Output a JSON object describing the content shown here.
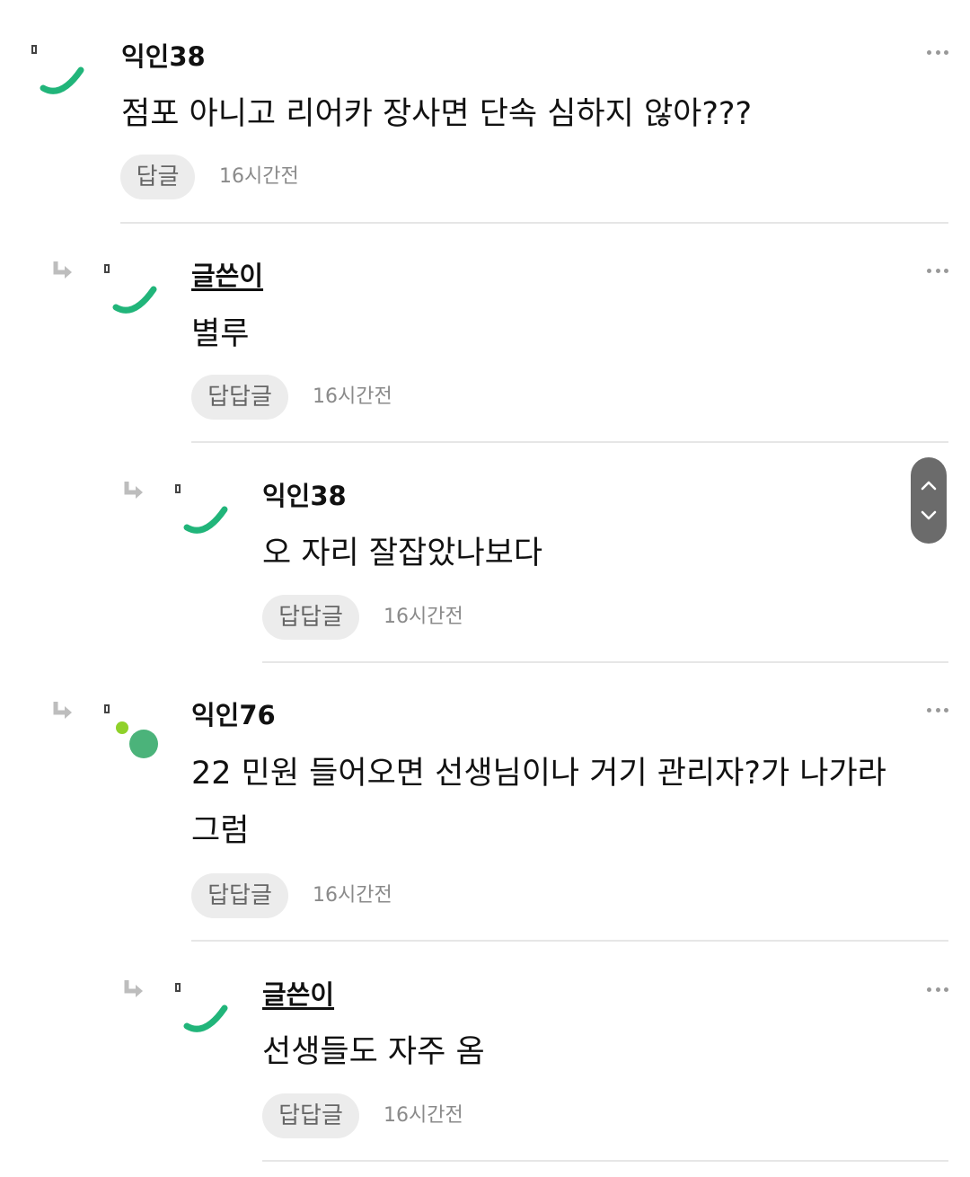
{
  "colors": {
    "avatar_green": "#21b57a",
    "dot_lime": "#8fd12a",
    "dot_green": "#4bb37a",
    "reply_button_bg": "#ececec"
  },
  "comments": [
    {
      "author": "익인38",
      "text": "점포 아니고 리어카 장사면 단속 심하지 않아???",
      "reply_label": "답글",
      "time": "16시간전"
    },
    {
      "author": "글쓴이",
      "text": "별루",
      "reply_label": "답답글",
      "time": "16시간전"
    },
    {
      "author": "익인38",
      "text": "오 자리 잘잡았나보다",
      "reply_label": "답답글",
      "time": "16시간전"
    },
    {
      "author": "익인76",
      "text_line1": "22 민원 들어오면 선생님이나 거기 관리자?가 나가라",
      "text_line2": "그럼",
      "reply_label": "답답글",
      "time": "16시간전"
    },
    {
      "author": "글쓴이",
      "text": "선생들도 자주 옴",
      "reply_label": "답답글",
      "time": "16시간전"
    }
  ],
  "icons": {
    "more": "more-horizontal-icon",
    "reply_arrow": "reply-arrow-icon",
    "scroll_up": "chevron-up-icon",
    "scroll_down": "chevron-down-icon"
  }
}
